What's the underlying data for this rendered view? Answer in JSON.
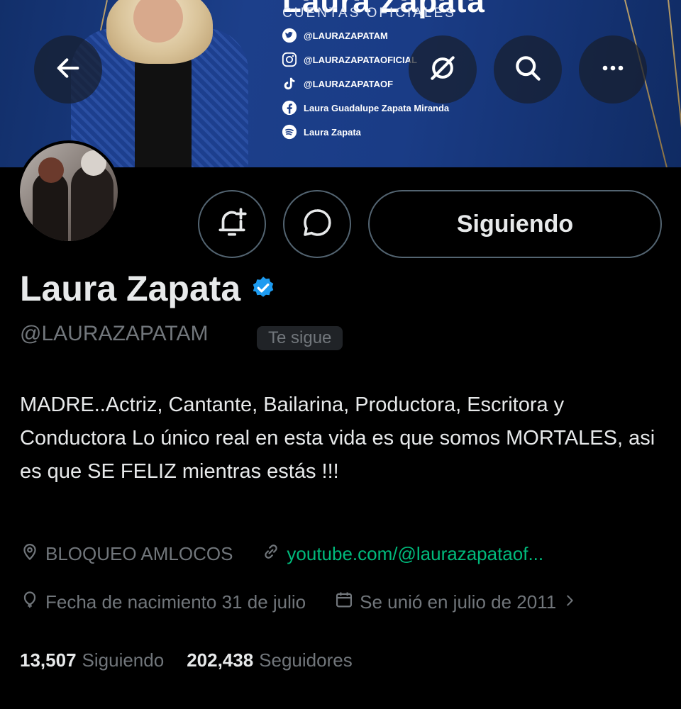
{
  "banner": {
    "title": "Laura Zapata",
    "subtitle": "CUENTAS OFICIALES",
    "socials": [
      {
        "icon": "twitter-icon",
        "label": "@LAURAZAPATAM"
      },
      {
        "icon": "instagram-icon",
        "label": "@LAURAZAPATAOFICIAL"
      },
      {
        "icon": "tiktok-icon",
        "label": "@LAURAZAPATAOF"
      },
      {
        "icon": "facebook-icon",
        "label": "Laura Guadalupe Zapata Miranda"
      },
      {
        "icon": "spotify-icon",
        "label": "Laura Zapata"
      }
    ]
  },
  "toolbar": {
    "back_icon": "arrow-left-icon",
    "grok_icon": "grok-icon",
    "search_icon": "search-icon",
    "more_icon": "more-icon"
  },
  "actions": {
    "notify_icon": "bell-plus-icon",
    "message_icon": "message-icon",
    "follow_label": "Siguiendo"
  },
  "profile": {
    "name": "Laura Zapata",
    "verified": true,
    "handle": "@LAURAZAPATAM",
    "follows_you": "Te sigue",
    "bio": "MADRE..Actriz, Cantante, Bailarina, Productora, Escritora y Conductora Lo único real en esta vida es que somos MORTALES, asi es que SE FELIZ mientras estás !!!",
    "location": "BLOQUEO AMLOCOS",
    "website": "youtube.com/@laurazapataof...",
    "birthday": "Fecha de nacimiento 31 de julio",
    "joined": "Se unió en julio de 2011"
  },
  "stats": {
    "following_count": "13,507",
    "following_label": "Siguiendo",
    "followers_count": "202,438",
    "followers_label": "Seguidores"
  },
  "colors": {
    "background": "#000000",
    "text": "#e7e9ea",
    "muted": "#71767b",
    "border": "#536471",
    "verified": "#1d9bf0",
    "link": "#00ba7c"
  }
}
